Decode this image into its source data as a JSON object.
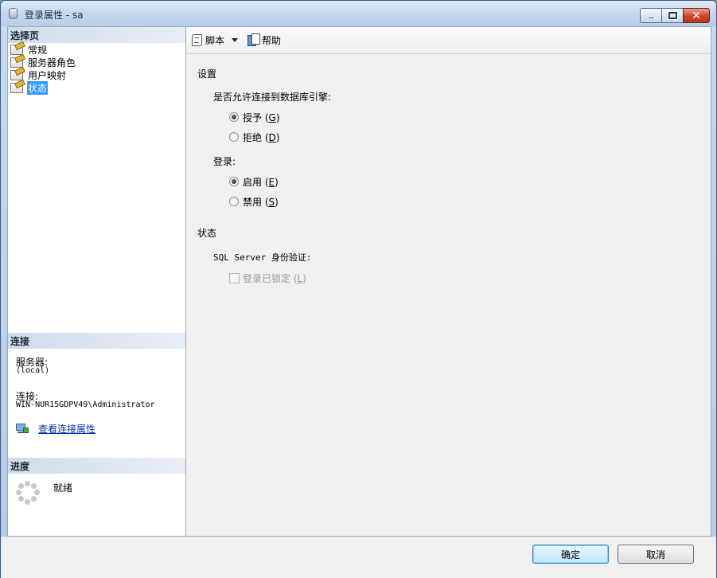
{
  "window": {
    "title": "登录属性 - sa"
  },
  "left": {
    "select_page_header": "选择页",
    "pages": [
      {
        "label": "常规",
        "selected": false
      },
      {
        "label": "服务器角色",
        "selected": false
      },
      {
        "label": "用户映射",
        "selected": false
      },
      {
        "label": "状态",
        "selected": true
      }
    ],
    "connection_header": "连接",
    "server_label": "服务器:",
    "server_value": "(local)",
    "connection_label": "连接:",
    "connection_value": "WIN-NUR15GDPV49\\Administrator",
    "view_connection_link": "查看连接属性",
    "progress_header": "进度",
    "progress_status": "就绪"
  },
  "toolbar": {
    "script_label": "脚本",
    "help_label": "帮助"
  },
  "settings": {
    "section_title": "设置",
    "permission_label": "是否允许连接到数据库引擎:",
    "grant_label": "授予",
    "grant_key": "G",
    "deny_label": "拒绝",
    "deny_key": "D",
    "login_label": "登录:",
    "enabled_label": "启用",
    "enabled_key": "E",
    "disabled_label": "禁用",
    "disabled_key": "S"
  },
  "status": {
    "section_title": "状态",
    "sql_auth_label": "SQL Server 身份验证:",
    "locked_label": "登录已锁定",
    "locked_key": "L"
  },
  "buttons": {
    "ok": "确定",
    "cancel": "取消"
  }
}
